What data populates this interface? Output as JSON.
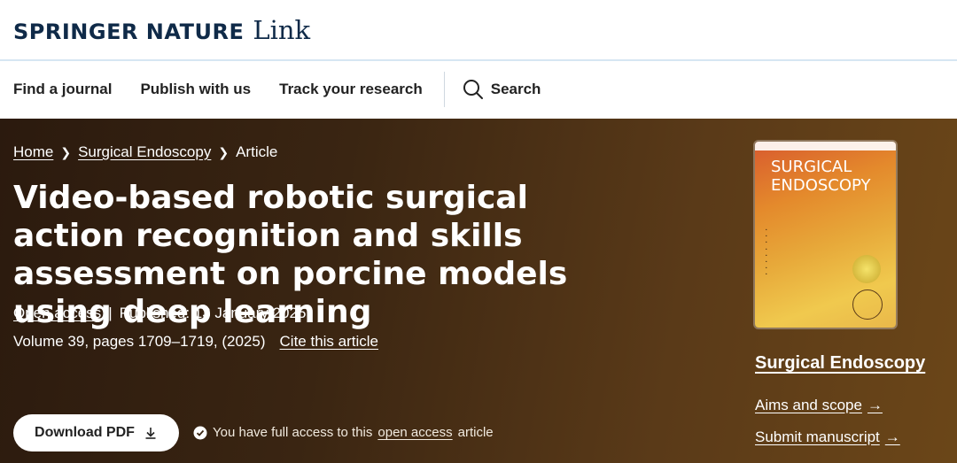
{
  "header": {
    "brand": "SPRINGER NATURE",
    "product": "Link"
  },
  "nav": {
    "items": [
      "Find a journal",
      "Publish with us",
      "Track your research"
    ],
    "search_label": "Search"
  },
  "breadcrumb": {
    "items": [
      "Home",
      "Surgical Endoscopy",
      "Article"
    ]
  },
  "article": {
    "title": "Video-based robotic surgical action recognition and skills assessment on porcine models using deep learning",
    "open_access": "Open access",
    "published": "Published: 13 January 2025",
    "volume": "Volume 39, pages 1709–1719, (2025)",
    "cite": "Cite this article"
  },
  "actions": {
    "download_label": "Download PDF",
    "access_prefix": "You have full access to this",
    "access_link": "open access",
    "access_suffix": "article"
  },
  "journal": {
    "cover_title": "SURGICAL ENDOSCOPY",
    "name": "Surgical Endoscopy",
    "aims_label": "Aims and scope",
    "submit_label": "Submit manuscript"
  },
  "colors": {
    "brand_navy": "#0f2a48",
    "hero_bg": "#3a2512"
  }
}
